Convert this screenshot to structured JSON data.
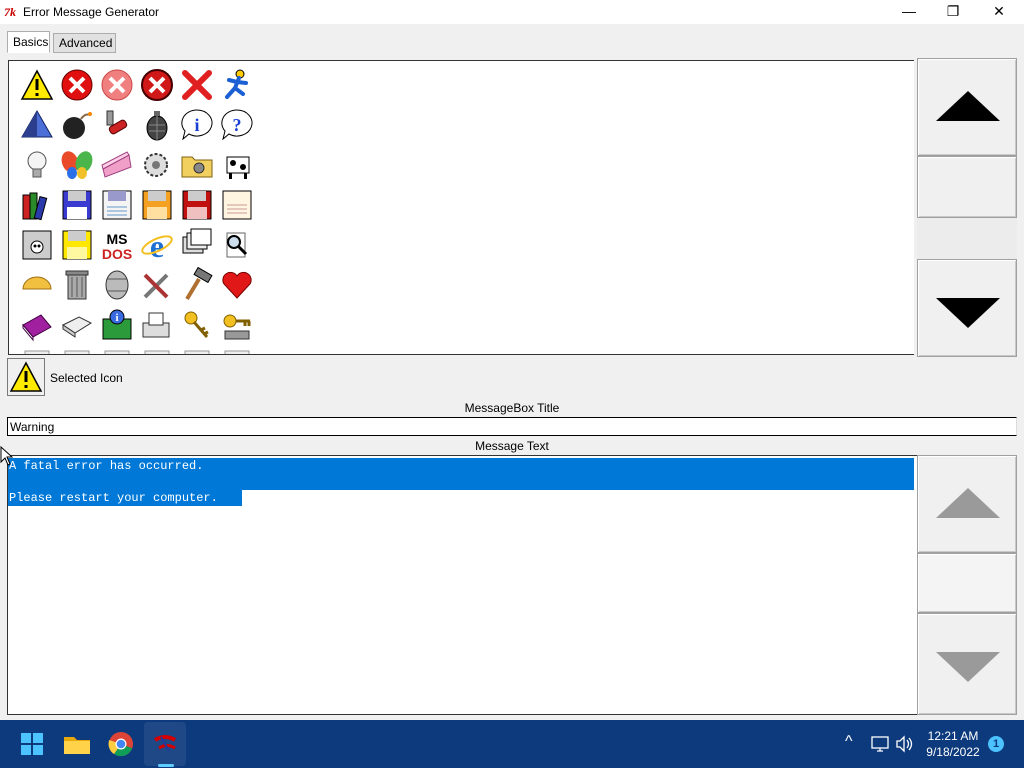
{
  "window": {
    "title": "Error Message Generator",
    "app_icon_glyph": "7k",
    "minimize_glyph": "—",
    "maximize_glyph": "❐",
    "close_glyph": "✕"
  },
  "tabs": [
    {
      "label": "Basics",
      "active": true
    },
    {
      "label": "Advanced",
      "active": false
    }
  ],
  "icon_grid": {
    "rows": [
      [
        "warning-icon",
        "error-red-x-icon",
        "error-faded-x-icon",
        "error-dark-x-icon",
        "red-cross-icon",
        "aim-running-man-icon"
      ],
      [
        "blue-pyramid-icon",
        "bomb-icon",
        "pipe-wrench-icon",
        "grenade-icon",
        "info-bubble-icon",
        "question-bubble-icon"
      ],
      [
        "light-bulb-icon",
        "butterfly-icon",
        "cake-icon",
        "gear-box-icon",
        "folder-gear-icon",
        "cow-icon"
      ],
      [
        "books-icon",
        "floppy-blue-icon",
        "floppy-white-icon",
        "floppy-orange-icon",
        "floppy-red-icon",
        "floppy-paper-icon"
      ],
      [
        "floppy-skull-icon",
        "floppy-yellow-icon",
        "msdos-icon",
        "internet-explorer-icon",
        "windows-stack-icon",
        "magnifier-doc-icon"
      ],
      [
        "taco-icon",
        "trash-can-icon",
        "barrel-icon",
        "tools-icon",
        "hammer-icon",
        "heart-icon"
      ],
      [
        "purple-book-icon",
        "scanner-icon",
        "info-board-icon",
        "fax-icon",
        "keys-icon",
        "key-drive-icon"
      ]
    ]
  },
  "selected_icon": {
    "label": "Selected Icon",
    "icon": "warning-icon"
  },
  "messagebox_title": {
    "label": "MessageBox Title",
    "value": "Warning"
  },
  "message_text": {
    "label": "Message Text",
    "lines": [
      "A fatal error has occurred.",
      "",
      "Please restart your computer."
    ]
  },
  "taskbar": {
    "apps": [
      "start-icon",
      "file-explorer-icon",
      "chrome-icon",
      "tk-app-icon"
    ],
    "time": "12:21 AM",
    "date": "9/18/2022",
    "notification_count": "1",
    "chevron_glyph": "^"
  },
  "colors": {
    "selection": "#0078d7",
    "taskbar": "#0d3a7c",
    "warning_yellow": "#ffea00",
    "error_red": "#e01010"
  }
}
